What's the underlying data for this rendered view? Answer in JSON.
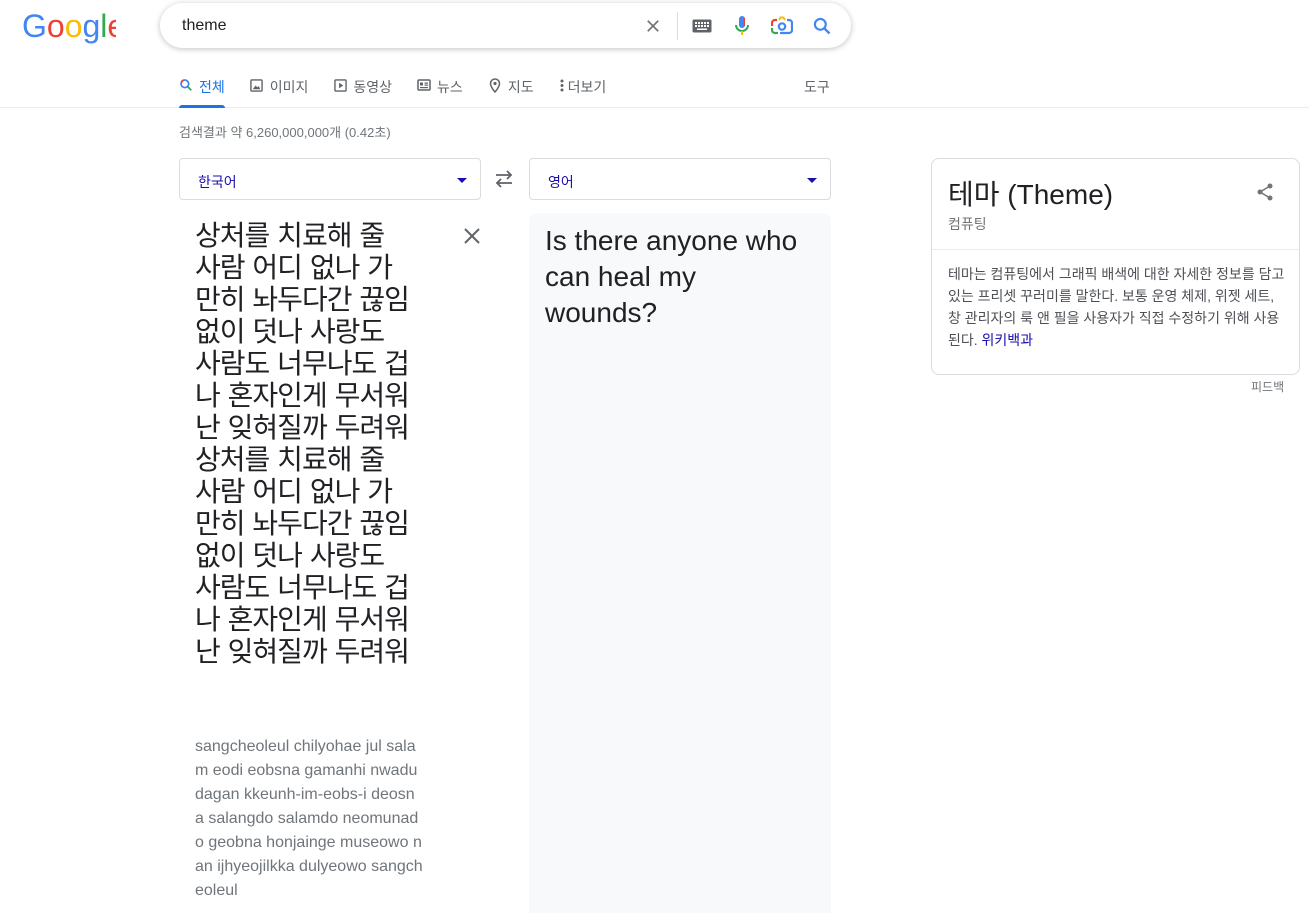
{
  "logo_text": "Google",
  "search": {
    "query": "theme",
    "icons": [
      "clear-icon",
      "keyboard-icon",
      "microphone-icon",
      "lens-camera-icon",
      "search-icon"
    ]
  },
  "tabs": [
    {
      "label": "전체",
      "icon": "search-icon",
      "active": true
    },
    {
      "label": "이미지",
      "icon": "image-icon"
    },
    {
      "label": "동영상",
      "icon": "video-icon"
    },
    {
      "label": "뉴스",
      "icon": "news-icon"
    },
    {
      "label": "지도",
      "icon": "map-pin-icon"
    },
    {
      "label": "더보기",
      "icon": "more-vert-icon"
    }
  ],
  "tools_label": "도구",
  "result_stats": "검색결과 약 6,260,000,000개 (0.42초)",
  "translate": {
    "source_lang": "한국어",
    "target_lang": "영어",
    "source_text": "상처를 치료해 줄 사람 어디 없나 가만히 놔두다간 끊임없이 덧나 사랑도 사람도 너무나도 겁나 혼자인게 무서워 난 잊혀질까 두려워 상처를 치료해 줄 사람 어디 없나 가만히 놔두다간 끊임없이 덧나 사랑도 사람도 너무나도 겁나 혼자인게 무서워 난 잊혀질까 두려워",
    "romanization": "sangcheoleul chilyohae jul salam eodi eobsna gamanhi nwadudagan kkeunh-im-eobs-i deosna salangdo salamdo neomunado geobna honjainge museowo nan ijhyeojilkka dulyeowo sangcheoleul",
    "target_text": "Is there anyone who can heal my wounds?"
  },
  "knowledge_panel": {
    "title": "테마 (Theme)",
    "subtitle": "컴퓨팅",
    "description": "테마는 컴퓨팅에서 그래픽 배색에 대한 자세한 정보를 담고 있는 프리셋 꾸러미를 말한다. 보통 운영 체제, 위젯 세트, 창 관리자의 룩 앤 필을 사용자가 직접 수정하기 위해 사용된다.",
    "link": "위키백과"
  },
  "feedback_label": "피드백",
  "colors": {
    "google_blue": "#4285F4",
    "google_red": "#EA4335",
    "google_yellow": "#FBBC05",
    "google_green": "#34A853",
    "link": "#1a0dab",
    "active_tab": "#1a73e8"
  }
}
